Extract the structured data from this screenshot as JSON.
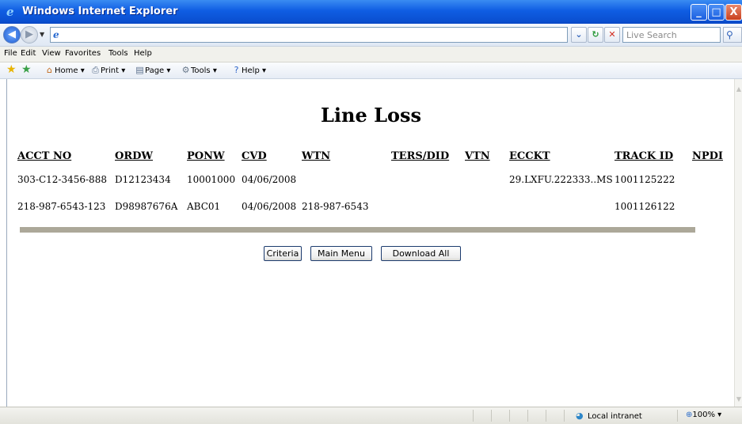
{
  "window": {
    "title": "Windows Internet Explorer",
    "min_glyph": "_",
    "max_glyph": "□",
    "close_glyph": "X"
  },
  "address_bar": {
    "url": "",
    "search_placeholder": "Live Search"
  },
  "menu": {
    "items": [
      "File",
      "Edit",
      "View",
      "Favorites",
      "Tools",
      "Help"
    ]
  },
  "command_bar": {
    "home": "Home",
    "print": "Print",
    "page": "Page",
    "tools": "Tools",
    "help": "Help"
  },
  "page": {
    "title": "Line Loss",
    "columns": [
      "ACCT NO",
      "ORDW",
      "PONW",
      "CVD",
      "WTN",
      "TERS/DID",
      "VTN",
      "ECCKT",
      "TRACK ID",
      "NPDI"
    ],
    "rows": [
      [
        "303-C12-3456-888",
        "D12123434",
        "10001000",
        "04/06/2008",
        "",
        "",
        "",
        "29.LXFU.222333..MS",
        "1001125222",
        ""
      ],
      [
        "218-987-6543-123",
        "D98987676A",
        "ABC01",
        "04/06/2008",
        "218-987-6543",
        "",
        "",
        "",
        "1001126122",
        ""
      ]
    ],
    "buttons": {
      "criteria": "Criteria",
      "main_menu": "Main Menu",
      "download_all": "Download All"
    }
  },
  "status_bar": {
    "zone": "Local intranet",
    "zoom": "100%"
  },
  "colors": {
    "titlebar": "#0f5de3",
    "divider": "#aca899",
    "button_border": "#1c3b6e"
  }
}
